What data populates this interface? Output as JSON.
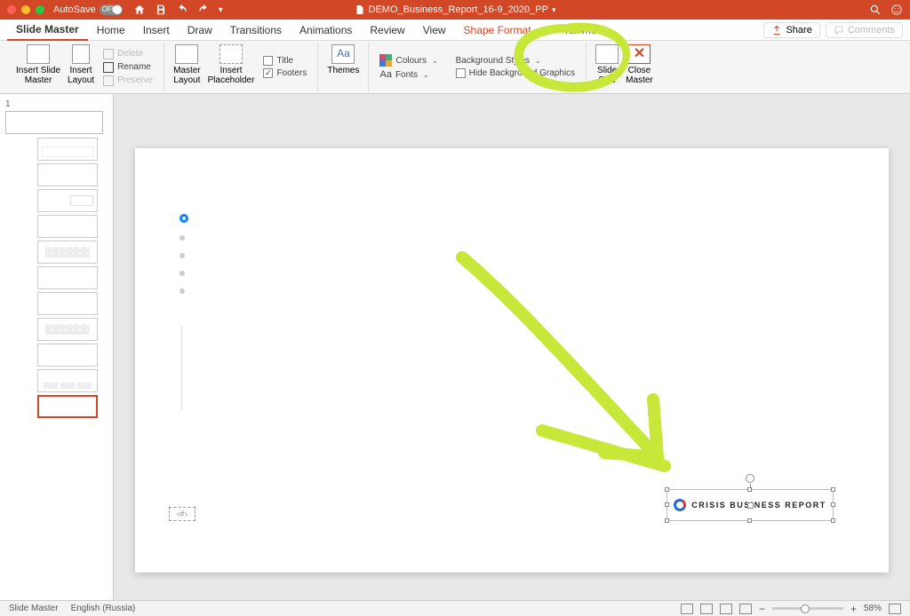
{
  "title_bar": {
    "autosave": "AutoSave",
    "autosave_state": "OFF",
    "filename": "DEMO_Business_Report_16-9_2020_PP"
  },
  "tabs": {
    "slide_master": "Slide Master",
    "home": "Home",
    "insert": "Insert",
    "draw": "Draw",
    "transitions": "Transitions",
    "animations": "Animations",
    "review": "Review",
    "view": "View",
    "shape_format": "Shape Format",
    "tell_me": "Tell me"
  },
  "tabs_right": {
    "share": "Share",
    "comments": "Comments"
  },
  "ribbon": {
    "insert_slide_master": "Insert Slide\nMaster",
    "insert_layout": "Insert\nLayout",
    "delete": "Delete",
    "rename": "Rename",
    "preserve": "Preserve",
    "master_layout": "Master\nLayout",
    "insert_placeholder": "Insert\nPlaceholder",
    "title": "Title",
    "footers": "Footers",
    "themes": "Themes",
    "colours": "Colours",
    "fonts": "Fonts",
    "background_styles": "Background Styles",
    "hide_bg": "Hide Background Graphics",
    "slide_size": "Slide\nSize",
    "close_master": "Close\nMaster"
  },
  "thumbnails": {
    "number": "1"
  },
  "slide": {
    "placeholder_pagenum": "‹#›",
    "logo_text": "CRISIS BUSINESS REPORT"
  },
  "status": {
    "mode": "Slide Master",
    "language": "English (Russia)",
    "zoom": "58%"
  }
}
